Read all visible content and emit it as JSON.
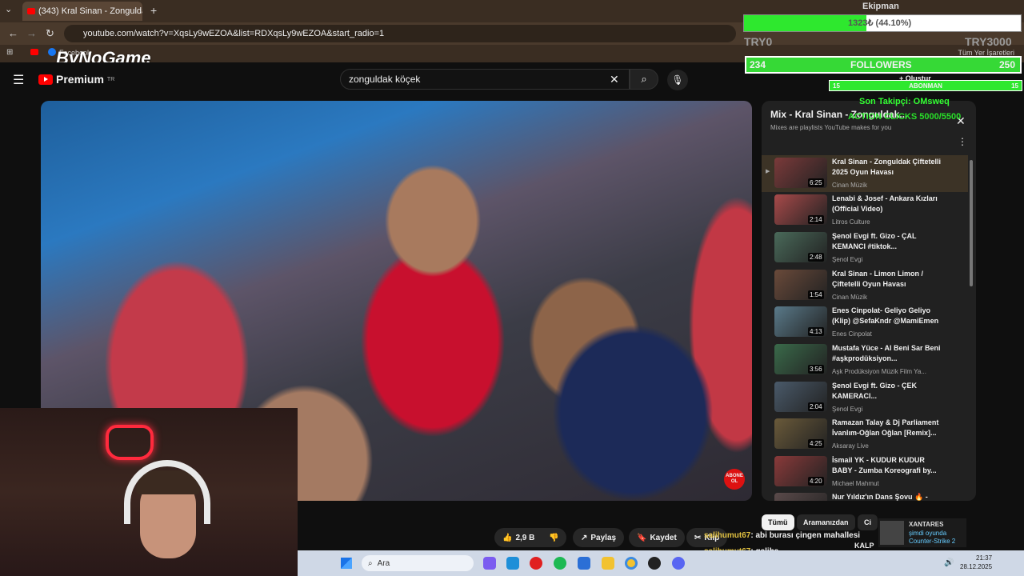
{
  "browser": {
    "tab_title": "(343) Kral Sinan - Zonguldak Ç",
    "url": "youtube.com/watch?v=XqsLy9wEZOA&list=RDXqsLy9wEZOA&start_radio=1",
    "bookmark_all": "Tüm Yer İşaretleri",
    "new_tab": "+",
    "close": "✕"
  },
  "youtube": {
    "premium_label": "Premium",
    "region": "TR",
    "search_value": "zonguldak köçek",
    "create_label": "Oluştur"
  },
  "video": {
    "subscribe_badge": [
      "ABONE",
      "OL"
    ]
  },
  "playlist": {
    "title": "Mix - Kral Sinan - Zonguldak...",
    "subtitle": "Mixes are playlists YouTube makes for you",
    "items": [
      {
        "title": "Kral Sinan - Zonguldak Çiftetelli 2025 Oyun Havası",
        "channel": "Cinan Müzik",
        "duration": "6:25",
        "thumb": "#7b3a3a"
      },
      {
        "title": "Lenabi & Josef - Ankara Kızları (Official Video)",
        "channel": "Litros Culture",
        "duration": "2:14",
        "thumb": "#a84a4a"
      },
      {
        "title": "Şenol Evgi ft. Gizo - ÇAL KEMANCI #tiktok...",
        "channel": "Şenol Evgi",
        "duration": "2:48",
        "thumb": "#4a6a5a"
      },
      {
        "title": "Kral Sinan - Limon Limon / Çiftetelli Oyun Havası",
        "channel": "Cinan Müzik",
        "duration": "1:54",
        "thumb": "#6a4a3a"
      },
      {
        "title": "Enes Cinpolat- Geliyo Geliyo (Klip) @SefaKndr @MamiEmen",
        "channel": "Enes Cinpolat",
        "duration": "4:13",
        "thumb": "#5a7a8a"
      },
      {
        "title": "Mustafa Yüce - Al Beni Sar Beni #aşkprodüksiyon...",
        "channel": "Aşk Prodüksiyon Müzik Film Ya...",
        "duration": "3:56",
        "thumb": "#3a6a4a"
      },
      {
        "title": "Şenol Evgi ft. Gizo - ÇEK KAMERACI...",
        "channel": "Şenol Evgi",
        "duration": "2:04",
        "thumb": "#4a5a6a"
      },
      {
        "title": "Ramazan Talay & Dj Parliament İvanlım-Oğlan Oğlan [Remix]...",
        "channel": "Aksaray Live",
        "duration": "4:25",
        "thumb": "#6a5a3a"
      },
      {
        "title": "İsmail YK - KUDUR KUDUR BABY - Zumba Koreografi by...",
        "channel": "Michael Mahmut",
        "duration": "4:20",
        "thumb": "#8a3a3a"
      },
      {
        "title": "Nur Yıldız'ın Dans Şovu 🔥 -",
        "channel": "",
        "duration": "",
        "thumb": "#5a4a4a"
      }
    ]
  },
  "actions": {
    "likes": "2,9 B",
    "share": "Paylaş",
    "save": "Kaydet",
    "clip": "Klip"
  },
  "chips": [
    "Tümü",
    "Aramanızdan",
    "Ci"
  ],
  "overlay": {
    "name": "Ekipman",
    "progress_text": "1323₺ (44.10%)",
    "progress_fraction": 0.441,
    "left_label": "TRY0",
    "right_label": "TRY3000",
    "followers_count": "234",
    "followers_label": "FOLLOWERS",
    "followers_goal": "250",
    "abone_label": "ABONMAN",
    "abone_left": "15",
    "abone_right": "15",
    "last_follower": "Son Takipçi: OMsweq",
    "clicks": "ACTION CLICKS 5000/5500",
    "brand": "ByNoGame",
    "facebook": "Facebook"
  },
  "chat": [
    {
      "user": "salihumut67",
      "text": ": abi burası çingen mahallesi"
    },
    {
      "user": "salihumut67",
      "text": ": galiba"
    }
  ],
  "notification": {
    "name": "XANTARES",
    "status": "şimdi oyunda",
    "game": "Counter-Strike 2"
  },
  "taskbar": {
    "search": "Ara",
    "time": "21:37",
    "date": "28.12.2025"
  },
  "misc": {
    "kalp": "KALP"
  }
}
